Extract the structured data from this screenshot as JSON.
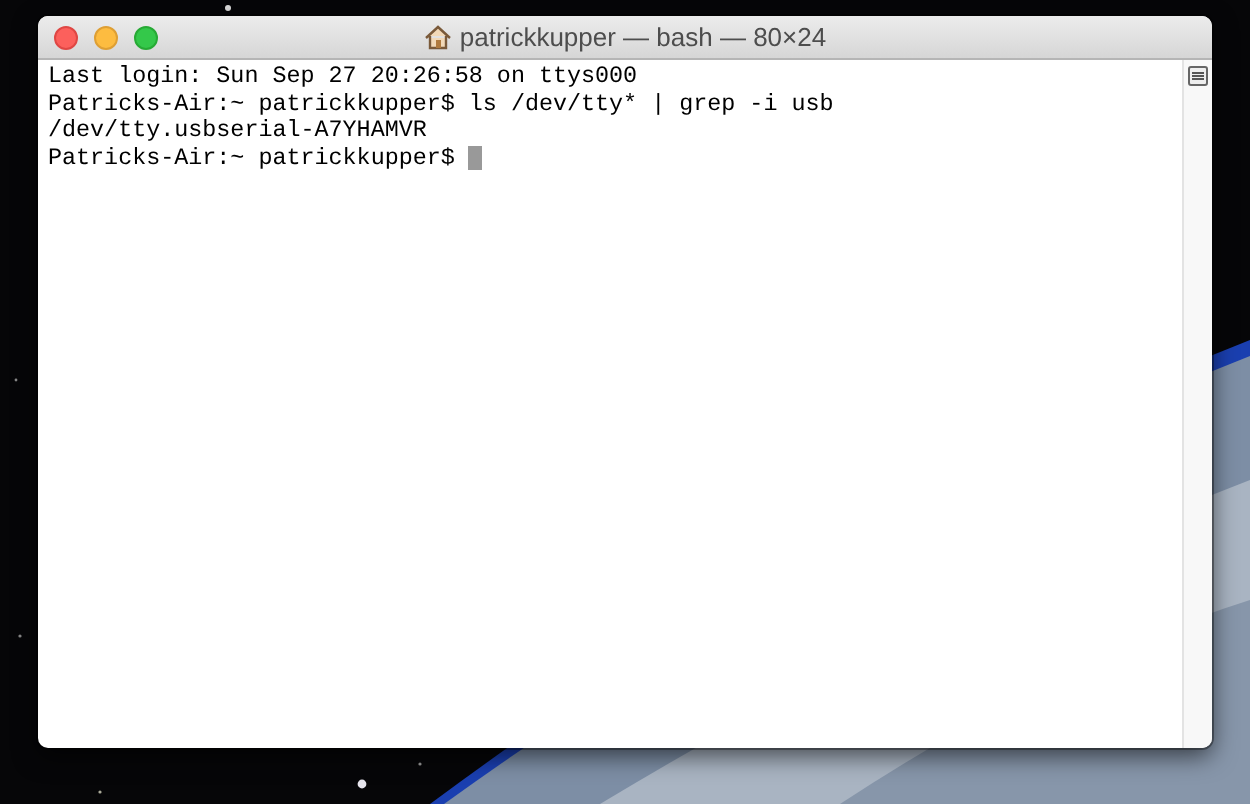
{
  "window": {
    "title": "patrickkupper — bash — 80×24"
  },
  "terminal": {
    "lines": [
      "Last login: Sun Sep 27 20:26:58 on ttys000",
      "Patricks-Air:~ patrickkupper$ ls /dev/tty* | grep -i usb",
      "/dev/tty.usbserial-A7YHAMVR",
      "Patricks-Air:~ patrickkupper$ "
    ]
  }
}
